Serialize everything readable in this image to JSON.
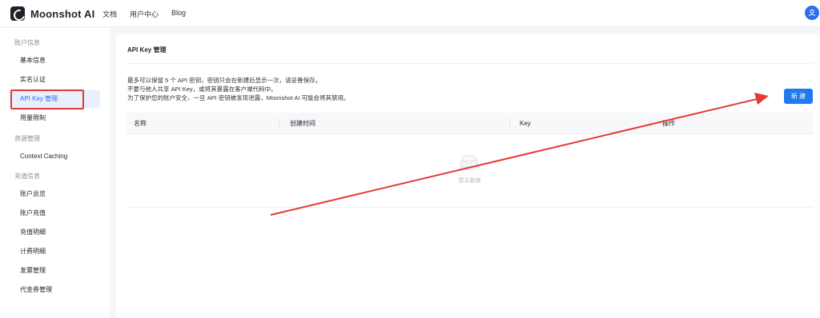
{
  "brand": {
    "name": "Moonshot AI"
  },
  "topnav": {
    "items": [
      "文档",
      "用户中心",
      "Blog"
    ]
  },
  "sidebar": {
    "groups": [
      {
        "title": "账户信息",
        "items": [
          "基本信息",
          "实名认证",
          "API Key 管理",
          "用量限制"
        ]
      },
      {
        "title": "资源管理",
        "items": [
          "Context Caching"
        ]
      },
      {
        "title": "充值信息",
        "items": [
          "账户总览",
          "账户充值",
          "充值明细",
          "计费明细",
          "发票管理",
          "代金券管理"
        ]
      }
    ],
    "active": "API Key 管理"
  },
  "main": {
    "title": "API Key 管理",
    "notes": [
      "最多可以保留 5 个 API 密钥，密钥只会在新建后显示一次，请妥善保存。",
      "不要与他人共享 API Key，或将其暴露在客户端代码中。",
      "为了保护您的账户安全，一旦 API 密钥被发现泄露，Moonshot AI 可能会将其禁用。"
    ],
    "new_button": "新 建",
    "table": {
      "columns": [
        "名称",
        "创建时间",
        "Key",
        "操作"
      ],
      "empty_text": "暂无数据"
    }
  },
  "colors": {
    "primary": "#1f7af0",
    "active_bg": "#e8f0fe",
    "annotation": "#e53935"
  }
}
